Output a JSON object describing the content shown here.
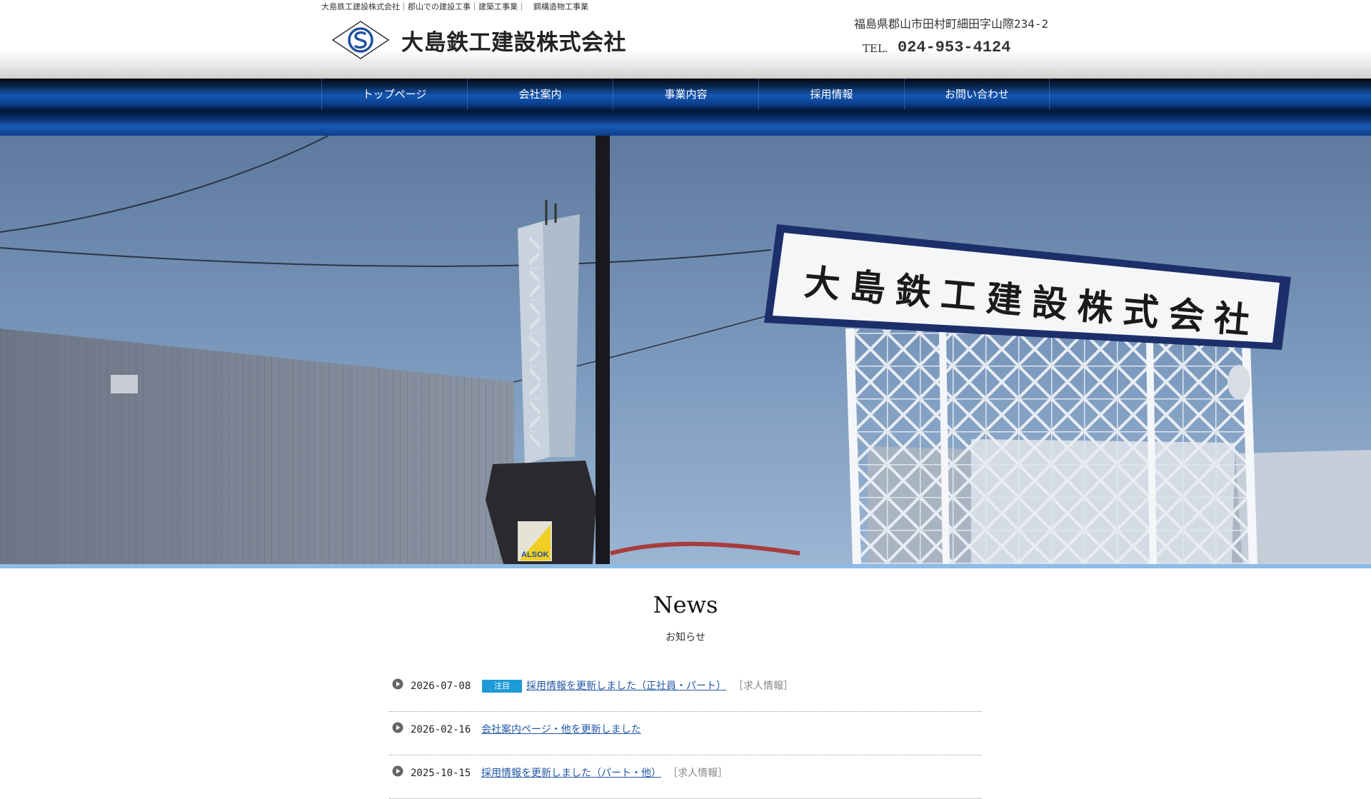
{
  "header": {
    "tagline": "大島鉄工建設株式会社｜郡山での建設工事｜建築工事業｜　鋼構造物工事業",
    "company_name": "大島鉄工建設株式会社",
    "address": "福島県郡山市田村町細田字山際234-2",
    "tel_label": "TEL.",
    "tel_number": "024-953-4124"
  },
  "nav": {
    "items": [
      {
        "label": "トップページ"
      },
      {
        "label": "会社案内"
      },
      {
        "label": "事業内容"
      },
      {
        "label": "採用情報"
      },
      {
        "label": "お問い合わせ"
      }
    ]
  },
  "hero": {
    "sign_text": "大島鉄工建設株式会社",
    "security_text": "ALSOK"
  },
  "news": {
    "title": "News",
    "subtitle": "お知らせ",
    "items": [
      {
        "date": "2026-07-08",
        "badge": "注目",
        "title": "採用情報を更新しました（正社員・パート）",
        "category": "［求人情報］"
      },
      {
        "date": "2026-02-16",
        "badge": "",
        "title": "会社案内ページ・他を更新しました",
        "category": ""
      },
      {
        "date": "2025-10-15",
        "badge": "",
        "title": "採用情報を更新しました（パート・他）",
        "category": "［求人情報］"
      }
    ]
  }
}
